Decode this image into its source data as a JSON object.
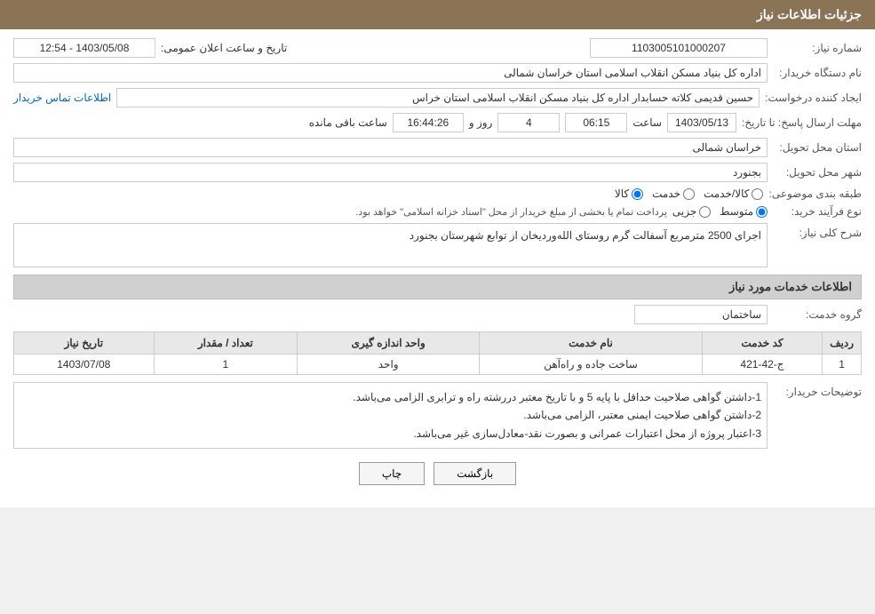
{
  "page": {
    "header": "جزئیات اطلاعات نیاز",
    "fields": {
      "need_number_label": "شماره نیاز:",
      "need_number_value": "1103005101000207",
      "announcement_label": "تاریخ و ساعت اعلان عمومی:",
      "announcement_value": "1403/05/08 - 12:54",
      "buyer_org_label": "نام دستگاه خریدار:",
      "buyer_org_value": "اداره کل بنیاد مسکن انقلاب اسلامی استان خراسان شمالی",
      "creator_label": "ایجاد کننده درخواست:",
      "creator_value": "حسین قدیمی کلاته حسابدار اداره کل بنیاد مسکن انقلاب اسلامی استان خراس",
      "contact_link": "اطلاعات تماس خریدار",
      "deadline_label": "مهلت ارسال پاسخ: تا تاریخ:",
      "deadline_date": "1403/05/13",
      "deadline_time_label": "ساعت",
      "deadline_time": "06:15",
      "deadline_days_label": "روز و",
      "deadline_days": "4",
      "deadline_remaining_label": "ساعت باقی مانده",
      "deadline_remaining": "16:44:26",
      "province_label": "استان محل تحویل:",
      "province_value": "خراسان شمالی",
      "city_label": "شهر محل تحویل:",
      "city_value": "بجنورد",
      "category_label": "طبقه بندی موضوعی:",
      "category_options": [
        "کالا",
        "خدمت",
        "کالا/خدمت"
      ],
      "category_selected": "کالا",
      "process_label": "نوع فرآیند خرید:",
      "process_options": [
        "جزیی",
        "متوسط"
      ],
      "process_selected": "متوسط",
      "process_note": "پرداخت تمام یا بخشی از مبلغ خریدار از محل \"اسناد خزانه اسلامی\" خواهد بود.",
      "need_desc_label": "شرح کلی نیاز:",
      "need_desc_value": "اجرای 2500 مترمربع آسفالت گرم روستای الله‌وردیخان از توابع شهرستان بجنورد",
      "services_header": "اطلاعات خدمات مورد نیاز",
      "service_group_label": "گروه خدمت:",
      "service_group_value": "ساختمان",
      "table": {
        "headers": [
          "ردیف",
          "کد خدمت",
          "نام خدمت",
          "واحد اندازه گیری",
          "تعداد / مقدار",
          "تاریخ نیاز"
        ],
        "rows": [
          {
            "row": "1",
            "service_code": "ج-42-421",
            "service_name": "ساخت جاده و راه‌آهن",
            "unit": "واحد",
            "quantity": "1",
            "date": "1403/07/08"
          }
        ]
      },
      "buyer_notes_label": "توضیحات خریدار:",
      "buyer_notes_lines": [
        "1-داشتن گواهی صلاحیت حداقل با پایه 5 و با تاریخ معتبر دررشته راه و ترابری الزامی می‌باشد.",
        "2-داشتن گواهی صلاحیت ایمنی معتبر، الزامی می‌باشد.",
        "3-اعتبار پروژه از محل اعتبارات عمرانی و بصورت نقد-معادل‌سازی غیر می‌باشد."
      ],
      "btn_back": "بازگشت",
      "btn_print": "چاپ"
    }
  }
}
